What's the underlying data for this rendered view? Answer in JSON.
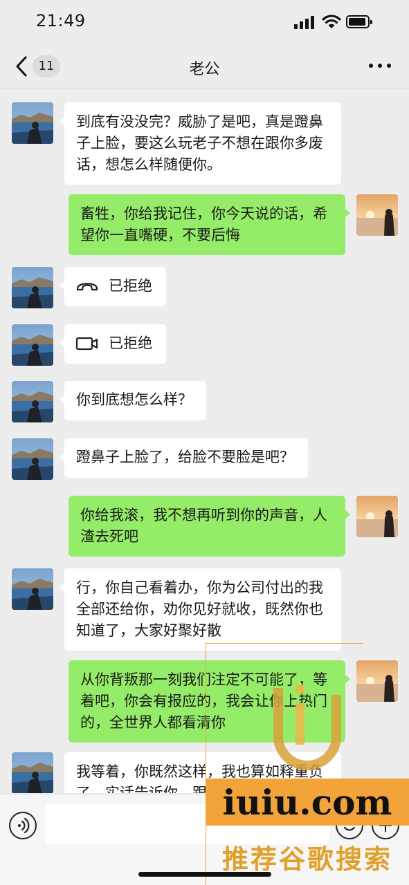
{
  "status_bar": {
    "time": "21:49"
  },
  "nav": {
    "unread_count": "11",
    "title": "老公"
  },
  "messages": [
    {
      "side": "left",
      "type": "text",
      "text": "到底有没没完？威胁了是吧，真是蹬鼻子上脸，要这么玩老子不想在跟你多废话，想怎么样随便你。"
    },
    {
      "side": "right",
      "type": "text",
      "text": "畜牲，你给我记住，你今天说的话，希望你一直嘴硬，不要后悔"
    },
    {
      "side": "left",
      "type": "voice-call",
      "icon": "phone-hangup-icon",
      "text": "已拒绝"
    },
    {
      "side": "left",
      "type": "video-call",
      "icon": "video-camera-icon",
      "text": "已拒绝"
    },
    {
      "side": "left",
      "type": "text",
      "text": "你到底想怎么样？"
    },
    {
      "side": "left",
      "type": "text",
      "text": "蹬鼻子上脸了，给脸不要脸是吧？"
    },
    {
      "side": "right",
      "type": "text",
      "text": "你给我滚，我不想再听到你的声音，人渣去死吧"
    },
    {
      "side": "left",
      "type": "text",
      "text": "行，你自己看着办，你为公司付出的我全部还给你，劝你见好就收，既然你也知道了，大家好聚好散"
    },
    {
      "side": "right",
      "type": "text",
      "text": "从你背叛那一刻我们注定不可能了，等着吧，你会有报应的，我会让你上热门的，全世界人都看清你"
    },
    {
      "side": "left",
      "type": "text",
      "text": "我等着，你既然这样，我也算如释重负了，实话告诉你，跟"
    }
  ],
  "watermark": {
    "site": "iuiu.com",
    "slogan": "推荐谷歌搜索"
  },
  "colors": {
    "background": "#ededed",
    "self_bubble": "#95ec69",
    "other_bubble": "#ffffff",
    "watermark_orange": "#f2a33a"
  }
}
